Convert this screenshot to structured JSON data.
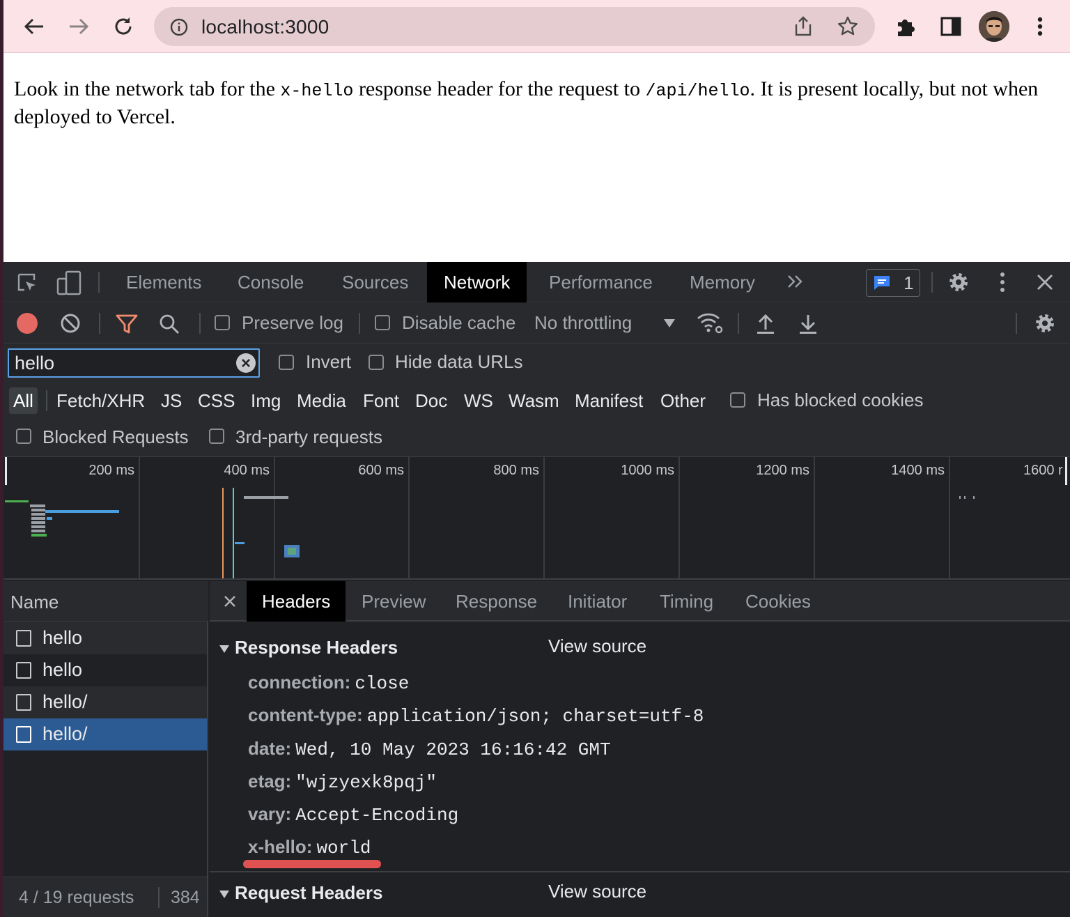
{
  "browser": {
    "url": "localhost:3000",
    "icons": [
      "back-icon",
      "forward-icon",
      "reload-icon",
      "site-info-icon",
      "share-icon",
      "bookmark-star-icon",
      "extensions-puzzle-icon",
      "side-panel-icon",
      "profile-avatar",
      "more-menu-icon"
    ]
  },
  "page": {
    "text_before_header": "Look in the network tab for the ",
    "header_code": "x-hello",
    "text_middle": " response header for the request to ",
    "path_code": "/api/hello",
    "text_after": ". It is present locally, but not when deployed to Vercel."
  },
  "devtools": {
    "tabs": [
      "Elements",
      "Console",
      "Sources",
      "Network",
      "Performance",
      "Memory"
    ],
    "active_tab": "Network",
    "message_count": "1",
    "toolbar": {
      "preserve_log": "Preserve log",
      "disable_cache": "Disable cache",
      "throttling": "No throttling"
    },
    "filter": {
      "value": "hello",
      "invert": "Invert",
      "hide_data_urls": "Hide data URLs"
    },
    "types": [
      "All",
      "Fetch/XHR",
      "JS",
      "CSS",
      "Img",
      "Media",
      "Font",
      "Doc",
      "WS",
      "Wasm",
      "Manifest",
      "Other"
    ],
    "has_blocked_cookies": "Has blocked cookies",
    "blocked_requests": "Blocked Requests",
    "third_party": "3rd-party requests",
    "timeline_ticks": [
      "200 ms",
      "400 ms",
      "600 ms",
      "800 ms",
      "1000 ms",
      "1200 ms",
      "1400 ms",
      "1600 r"
    ],
    "name_header": "Name",
    "requests": [
      "hello",
      "hello",
      "hello/",
      "hello/"
    ],
    "selected_request_index": 3,
    "status": {
      "count": "4 / 19 requests",
      "size": "384"
    },
    "detail_tabs": [
      "Headers",
      "Preview",
      "Response",
      "Initiator",
      "Timing",
      "Cookies"
    ],
    "active_detail_tab": "Headers",
    "response_headers_title": "Response Headers",
    "request_headers_title": "Request Headers",
    "view_source": "View source",
    "response_headers": [
      {
        "key": "connection:",
        "value": "close"
      },
      {
        "key": "content-type:",
        "value": "application/json; charset=utf-8"
      },
      {
        "key": "date:",
        "value": "Wed, 10 May 2023 16:16:42 GMT"
      },
      {
        "key": "etag:",
        "value": "\"wjzyexk8pqj\""
      },
      {
        "key": "vary:",
        "value": "Accept-Encoding"
      },
      {
        "key": "x-hello:",
        "value": "world"
      }
    ],
    "highlight_color": "#e05252",
    "selection_color": "#2c5b94"
  }
}
